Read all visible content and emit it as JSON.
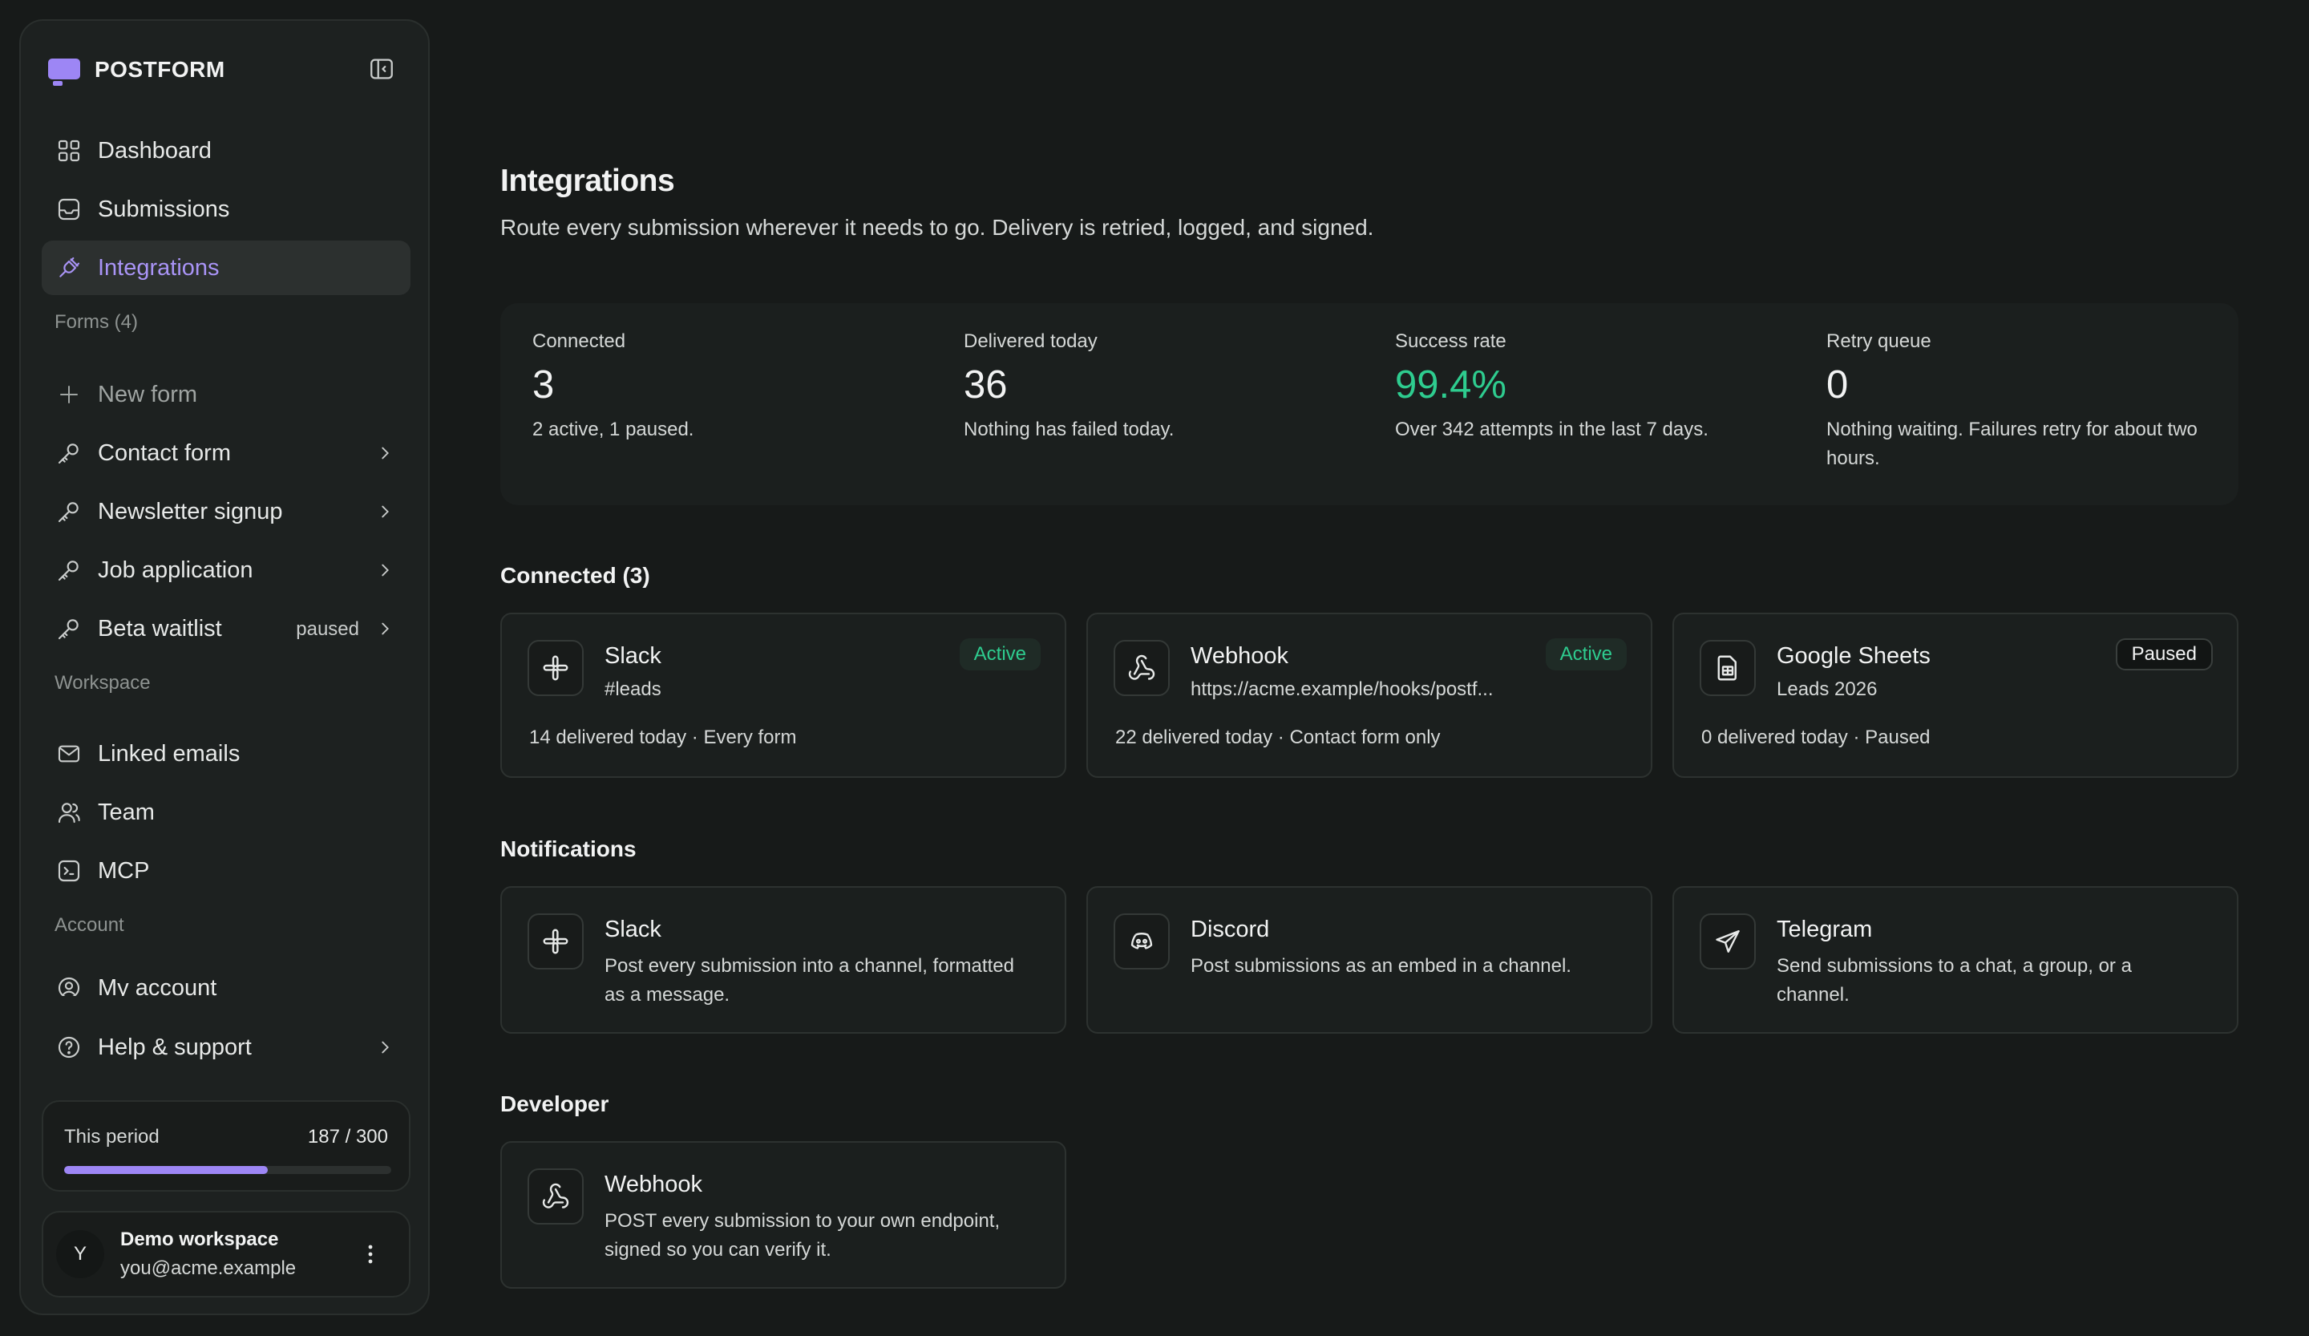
{
  "brand": {
    "name": "POSTFORM"
  },
  "nav": {
    "dashboard": "Dashboard",
    "submissions": "Submissions",
    "integrations": "Integrations"
  },
  "forms": {
    "section_label": "Forms (4)",
    "new_form": "New form",
    "items": [
      {
        "label": "Contact form",
        "tag": ""
      },
      {
        "label": "Newsletter signup",
        "tag": ""
      },
      {
        "label": "Job application",
        "tag": ""
      },
      {
        "label": "Beta waitlist",
        "tag": "paused"
      }
    ]
  },
  "workspace": {
    "section_label": "Workspace",
    "linked_emails": "Linked emails",
    "team": "Team",
    "mcp": "MCP"
  },
  "account": {
    "section_label": "Account",
    "my_account": "My account",
    "help": "Help & support"
  },
  "usage": {
    "label": "This period",
    "value": "187 / 300",
    "used": 187,
    "limit": 300
  },
  "user": {
    "initial": "Y",
    "name": "Demo workspace",
    "email": "you@acme.example"
  },
  "page": {
    "title": "Integrations",
    "subtitle": "Route every submission wherever it needs to go. Delivery is retried, logged, and signed."
  },
  "stats": [
    {
      "label": "Connected",
      "value": "3",
      "desc": "2 active, 1 paused."
    },
    {
      "label": "Delivered today",
      "value": "36",
      "desc": "Nothing has failed today."
    },
    {
      "label": "Success rate",
      "value": "99.4%",
      "desc": "Over 342 attempts in the last 7 days."
    },
    {
      "label": "Retry queue",
      "value": "0",
      "desc": "Nothing waiting. Failures retry for about two hours."
    }
  ],
  "connected": {
    "title": "Connected (3)",
    "items": [
      {
        "name": "Slack",
        "detail": "#leads",
        "status": "Active",
        "footer": "14 delivered today · Every form",
        "icon": "slack-icon"
      },
      {
        "name": "Webhook",
        "detail": "https://acme.example/hooks/postf...",
        "status": "Active",
        "footer": "22 delivered today · Contact form only",
        "icon": "webhook-icon"
      },
      {
        "name": "Google Sheets",
        "detail": "Leads 2026",
        "status": "Paused",
        "footer": "0 delivered today · Paused",
        "icon": "sheets-icon"
      }
    ]
  },
  "notifications": {
    "title": "Notifications",
    "items": [
      {
        "name": "Slack",
        "desc": "Post every submission into a channel, formatted as a message.",
        "icon": "slack-icon"
      },
      {
        "name": "Discord",
        "desc": "Post submissions as an embed in a channel.",
        "icon": "discord-icon"
      },
      {
        "name": "Telegram",
        "desc": "Send submissions to a chat, a group, or a channel.",
        "icon": "telegram-icon"
      }
    ]
  },
  "developer": {
    "title": "Developer",
    "items": [
      {
        "name": "Webhook",
        "desc": "POST every submission to your own endpoint, signed so you can verify it.",
        "icon": "webhook-icon"
      }
    ]
  },
  "colors": {
    "accent": "#9d86f5",
    "success": "#2ecc8f",
    "background": "#171a19"
  }
}
